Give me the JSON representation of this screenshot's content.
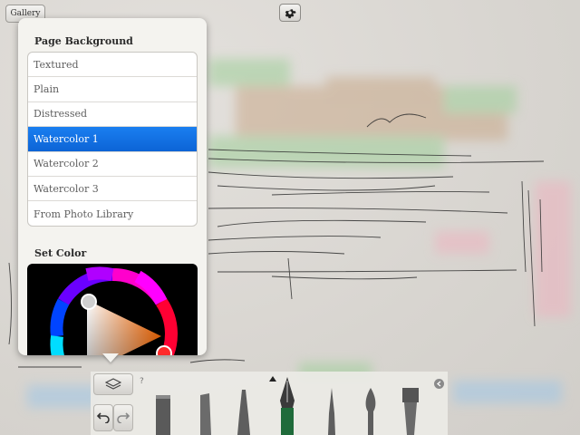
{
  "topbar": {
    "gallery_label": "Gallery",
    "settings_icon": "gear-icon"
  },
  "popover": {
    "background_title": "Page Background",
    "background_options": [
      {
        "label": "Textured",
        "selected": false
      },
      {
        "label": "Plain",
        "selected": false
      },
      {
        "label": "Distressed",
        "selected": false
      },
      {
        "label": "Watercolor 1",
        "selected": true
      },
      {
        "label": "Watercolor 2",
        "selected": false
      },
      {
        "label": "Watercolor 3",
        "selected": false
      },
      {
        "label": "From Photo Library",
        "selected": false
      }
    ],
    "color_title": "Set Color"
  },
  "toolbar": {
    "help_label": "?",
    "tools": [
      "layers-icon",
      "undo-icon",
      "redo-icon",
      "pencil-brush",
      "marker-brush",
      "ink-brush",
      "fountain-pen-brush",
      "fine-brush",
      "round-brush",
      "flat-brush",
      "close-icon"
    ]
  },
  "colors": {
    "selected_blue": "#1a7ff0",
    "popover_bg": "#f4f3ef"
  }
}
